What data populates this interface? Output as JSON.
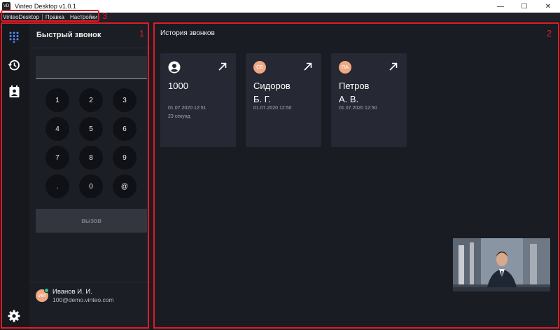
{
  "window": {
    "title": "Vinteo Desktop v1.0.1",
    "logo_text": "VD",
    "minimize": "—",
    "maximize": "☐",
    "close": "✕"
  },
  "menu": {
    "items": [
      "VinteoDesktop",
      "Правка",
      "Настройки"
    ]
  },
  "annotations": [
    "1",
    "2",
    "3"
  ],
  "rail": {
    "icons": [
      "dialpad-icon",
      "history-icon",
      "contacts-icon",
      "settings-icon"
    ]
  },
  "dialpad": {
    "title": "Быстрый звонок",
    "input_value": "",
    "keys": [
      "1",
      "2",
      "3",
      "4",
      "5",
      "6",
      "7",
      "8",
      "9",
      ".",
      "0",
      "@"
    ],
    "call_label": "вызов"
  },
  "user": {
    "initials": "ИИ",
    "name": "Иванов И. И.",
    "email": "100@demo.vinteo.com",
    "status_color": "#36c98b"
  },
  "history": {
    "title": "История звонков",
    "cards": [
      {
        "avatar": "",
        "avatar_icon": "account-icon",
        "name_line1": "1000",
        "name_line2": "",
        "date": "01.07.2020 12:51",
        "duration": "23 секунд"
      },
      {
        "avatar": "СБ",
        "name_line1": "Сидоров",
        "name_line2": "Б. Г.",
        "date": "01.07.2020 12:50",
        "duration": ""
      },
      {
        "avatar": "ПА",
        "name_line1": "Петров",
        "name_line2": "А. В.",
        "date": "01.07.2020 12:50",
        "duration": ""
      }
    ]
  },
  "colors": {
    "accent": "#e01b24",
    "avatar": "#f0a883",
    "background": "#1a1c23"
  }
}
